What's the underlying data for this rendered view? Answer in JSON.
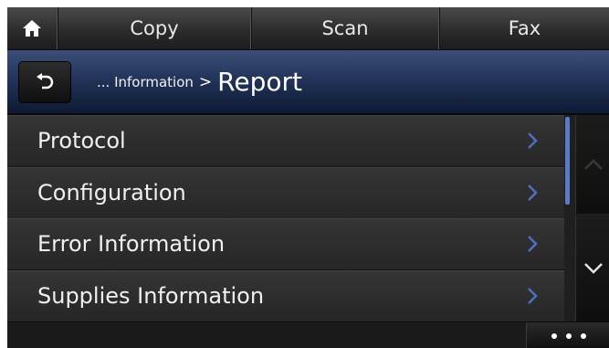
{
  "topbar": {
    "home_icon": "home-icon",
    "tabs": [
      {
        "label": "Copy"
      },
      {
        "label": "Scan"
      },
      {
        "label": "Fax"
      }
    ]
  },
  "header": {
    "back_icon": "back-arrow-icon",
    "breadcrumb_prefix": "... Information",
    "breadcrumb_separator": ">",
    "current": "Report"
  },
  "menu": {
    "items": [
      {
        "label": "Protocol",
        "icon": "chevron-right-icon"
      },
      {
        "label": "Configuration",
        "icon": "chevron-right-icon"
      },
      {
        "label": "Error Information",
        "icon": "chevron-right-icon"
      },
      {
        "label": "Supplies Information",
        "icon": "chevron-right-icon"
      }
    ]
  },
  "scroll": {
    "up_icon": "chevron-up-icon",
    "down_icon": "chevron-down-icon"
  },
  "bottombar": {
    "more_icon": "more-dots-icon"
  },
  "colors": {
    "accent": "#5b7bc8",
    "header": "#22345a",
    "chevron": "#4d6fc4"
  }
}
